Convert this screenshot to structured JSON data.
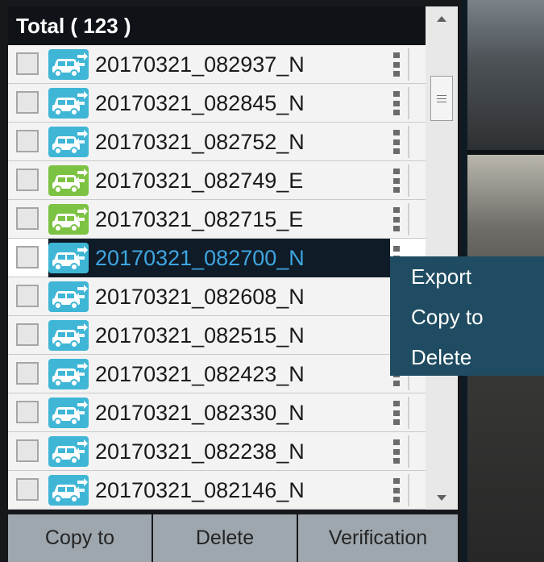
{
  "list": {
    "title": "Total ( 123 )",
    "items": [
      {
        "name": "20170321_082937_N",
        "type": "normal"
      },
      {
        "name": "20170321_082845_N",
        "type": "normal"
      },
      {
        "name": "20170321_082752_N",
        "type": "normal"
      },
      {
        "name": "20170321_082749_E",
        "type": "event"
      },
      {
        "name": "20170321_082715_E",
        "type": "event"
      },
      {
        "name": "20170321_082700_N",
        "type": "normal",
        "selected": true
      },
      {
        "name": "20170321_082608_N",
        "type": "normal"
      },
      {
        "name": "20170321_082515_N",
        "type": "normal"
      },
      {
        "name": "20170321_082423_N",
        "type": "normal"
      },
      {
        "name": "20170321_082330_N",
        "type": "normal"
      },
      {
        "name": "20170321_082238_N",
        "type": "normal"
      },
      {
        "name": "20170321_082146_N",
        "type": "normal"
      }
    ]
  },
  "context_menu": {
    "items": [
      "Export",
      "Copy to",
      "Delete"
    ]
  },
  "bottom_bar": {
    "copy_to": "Copy to",
    "delete": "Delete",
    "verification": "Verification"
  },
  "colors": {
    "normal_icon": "#3fb6d6",
    "event_icon": "#7cc243",
    "selected_text": "#3ea6e0",
    "menu_bg": "#1f4c62"
  },
  "icons": {
    "car": "car-transfer-icon",
    "row_menu": "vertical-dots-icon"
  }
}
